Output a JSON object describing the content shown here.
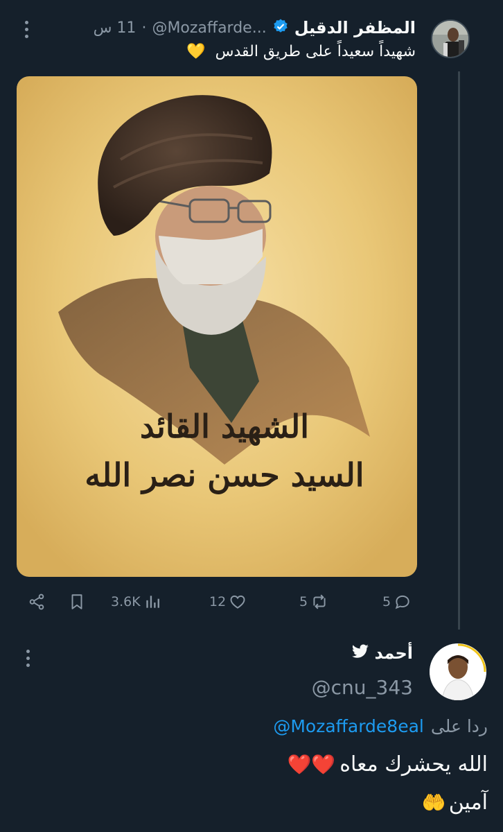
{
  "tweet": {
    "author_name": "المظفر الدقيل",
    "author_handle": "@Mozaffarde...",
    "time": "11 س",
    "separator": "·",
    "text": "شهيداً سعيداً على طريق القدس",
    "emoji": "💛",
    "image_calligraphy_line1": "الشهيد القائد",
    "image_calligraphy_line2": "السيد حسن نصر الله",
    "actions": {
      "views": "3.6K",
      "likes": "12",
      "retweets": "5",
      "replies": "5"
    }
  },
  "reply": {
    "author_name": "أحمد",
    "author_handle": "@cnu_343",
    "replying_to_label": "ردا على",
    "replying_to_handle": "@Mozaffarde8eal",
    "line1": "الله يحشرك معاه",
    "line1_emoji": "❤️❤️",
    "line2": "آمين",
    "line2_emoji": "🤲"
  },
  "colors": {
    "background": "#15202b",
    "text": "#f7f9f9",
    "muted": "#8b98a5",
    "link": "#1d9bf0",
    "verified": "#1d9bf0"
  },
  "icons": [
    "more-icon",
    "verified-badge-icon",
    "share-icon",
    "bookmark-icon",
    "views-icon",
    "like-icon",
    "retweet-icon",
    "reply-icon",
    "bird-icon"
  ]
}
